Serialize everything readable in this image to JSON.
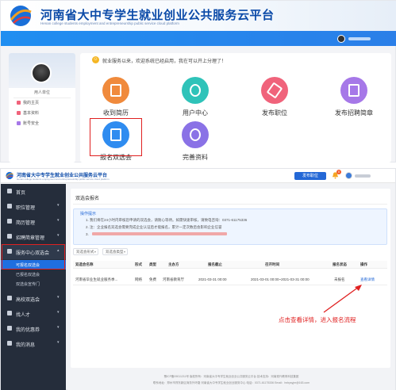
{
  "top": {
    "site_title": "河南省大中专学生就业创业公共服务云平台",
    "site_subtitle": "Henan college students employment and entrepreneurship public service cloud platform",
    "profile": {
      "name": "用人单位",
      "menu": [
        "我的主页",
        "基本资料",
        "账号安全"
      ]
    },
    "notice": "就业服务以来，欢迎系统已经启用，我在可以开上分理了！",
    "tiles": [
      {
        "label": "收到简历",
        "icon": "resume-icon",
        "color": "#f08a3c"
      },
      {
        "label": "用户中心",
        "icon": "user-center-icon",
        "color": "#2fc3b9"
      },
      {
        "label": "发布职位",
        "icon": "post-job-icon",
        "color": "#f0637b"
      },
      {
        "label": "发布招聘简章",
        "icon": "post-brochure-icon",
        "color": "#a678e8"
      },
      {
        "label": "报名双选会",
        "icon": "job-fair-icon",
        "color": "#2f8cf0"
      },
      {
        "label": "完善资料",
        "icon": "complete-profile-icon",
        "color": "#8a72e6"
      }
    ]
  },
  "bottom": {
    "header": {
      "title": "河南省大中专学生就业创业公共服务云平台",
      "subtitle": "Henan college students employment and entrepreneurship public service cloud platform",
      "publish_button": "发布职位",
      "badge_count": "0"
    },
    "sidebar": {
      "items": [
        {
          "label": "首页",
          "icon": "home-icon"
        },
        {
          "label": "职位管理",
          "icon": "briefcase-icon"
        },
        {
          "label": "简历管理",
          "icon": "resume-icon"
        },
        {
          "label": "招聘简章管理",
          "icon": "brochure-icon"
        },
        {
          "label": "服务中心双选会",
          "icon": "service-icon"
        }
      ],
      "subitems": [
        "可报名双选会",
        "已报名双选会",
        "双选会宣传门"
      ],
      "items_after": [
        {
          "label": "高校双选会",
          "icon": "school-icon"
        },
        {
          "label": "找人才",
          "icon": "talent-icon"
        },
        {
          "label": "我的优惠券",
          "icon": "coupon-icon"
        },
        {
          "label": "我的消息",
          "icon": "message-icon"
        }
      ]
    },
    "content": {
      "title": "双选会报名",
      "tip_title": "操作提示",
      "tip_lines": [
        "1. 我们将在24小时内审核您申请的双选会，请耐心等待。如需快速审核，请致电咨询：0371-61175336",
        "2. 注：企业报名双选会需要完成企业认证后才能报名，累计一定次数后会影响企业信誉",
        "3."
      ],
      "filters": [
        "双选会形式",
        "双选会类型"
      ],
      "columns": [
        "双选会名称",
        "形式",
        "类型",
        "主办方",
        "报名截止",
        "召开时间",
        "报名状态",
        "操作"
      ],
      "rows": [
        {
          "name": "河南省毕业生就业服务季...",
          "form": "网络",
          "type": "免费",
          "host": "河南省教育厅",
          "deadline": "2021-03-31 00:00",
          "time": "2021-03-01 00:00~2021-03-31 00:00",
          "status": "未报名",
          "action": "查看详情"
        }
      ]
    },
    "annotation": "点击查看详情，进入报名流程",
    "footer": [
      "豫ICP备09011211号 版权所有：河南省大中专学生就业创业公共服务云平台 技术支持：河南现代教育科技集团",
      "联系地址：郑州市郑东新区商务外环路 河南省大中专学生就业创业服务中心 电话：0371-61175336 Email：hnbysyjm@163.com"
    ]
  }
}
